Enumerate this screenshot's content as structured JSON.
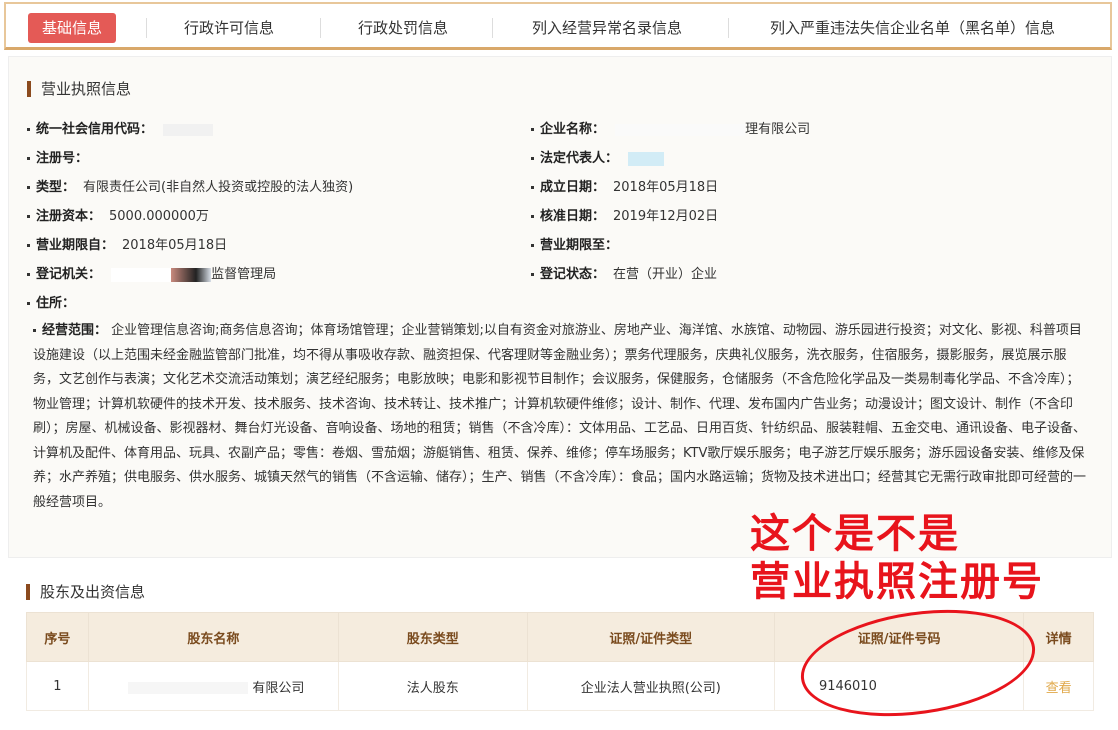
{
  "tabs": [
    {
      "label": "基础信息",
      "active": true
    },
    {
      "label": "行政许可信息",
      "active": false
    },
    {
      "label": "行政处罚信息",
      "active": false
    },
    {
      "label": "列入经营异常名录信息",
      "active": false
    },
    {
      "label": "列入严重违法失信企业名单（黑名单）信息",
      "active": false
    }
  ],
  "license": {
    "title": "营业执照信息",
    "credit_code_label": "统一社会信用代码：",
    "company_name_label": "企业名称：",
    "company_name_value": "理有限公司",
    "reg_no_label": "注册号：",
    "legal_rep_label": "法定代表人：",
    "type_label": "类型：",
    "type_value": "有限责任公司(非自然人投资或控股的法人独资)",
    "est_date_label": "成立日期：",
    "est_date_value": "2018年05月18日",
    "capital_label": "注册资本：",
    "capital_value": "5000.000000万",
    "approve_date_label": "核准日期：",
    "approve_date_value": "2019年12月02日",
    "term_from_label": "营业期限自：",
    "term_from_value": "2018年05月18日",
    "term_to_label": "营业期限至：",
    "authority_label": "登记机关：",
    "authority_value": "监督管理局",
    "status_label": "登记状态：",
    "status_value": "在营（开业）企业",
    "address_label": "住所：",
    "scope_label": "经营范围：",
    "scope_value": "企业管理信息咨询;商务信息咨询；体育场馆管理；企业营销策划;以自有资金对旅游业、房地产业、海洋馆、水族馆、动物园、游乐园进行投资；对文化、影视、科普项目设施建设（以上范围未经金融监管部门批准，均不得从事吸收存款、融资担保、代客理财等金融业务）；票务代理服务，庆典礼仪服务，洗衣服务，住宿服务，摄影服务，展览展示服务，文艺创作与表演；文化艺术交流活动策划；演艺经纪服务；电影放映；电影和影视节目制作；会议服务，保健服务，仓储服务（不含危险化学品及一类易制毒化学品、不含冷库）；物业管理；计算机软硬件的技术开发、技术服务、技术咨询、技术转让、技术推广；计算机软硬件维修；设计、制作、代理、发布国内广告业务；动漫设计；图文设计、制作（不含印刷）；房屋、机械设备、影视器材、舞台灯光设备、音响设备、场地的租赁；销售（不含冷库）：文体用品、工艺品、日用百货、针纺织品、服装鞋帽、五金交电、通讯设备、电子设备、计算机及配件、体育用品、玩具、农副产品；零售：卷烟、雪茄烟；游艇销售、租赁、保养、维修；停车场服务；KTV歌厅娱乐服务；电子游艺厅娱乐服务；游乐园设备安装、维修及保养；水产养殖；供电服务、供水服务、城镇天然气的销售（不含运输、储存）；生产、销售（不含冷库）：食品；国内水路运输；货物及技术进出口；经营其它无需行政审批即可经营的一般经营项目。"
  },
  "annotation": {
    "line1": "这个是不是",
    "line2": "营业执照注册号",
    "color": "#e8141c"
  },
  "shareholders": {
    "title": "股东及出资信息",
    "headers": [
      "序号",
      "股东名称",
      "股东类型",
      "证照/证件类型",
      "证照/证件号码",
      "详情"
    ],
    "rows": [
      [
        "1",
        "有限公司",
        "法人股东",
        "企业法人营业执照(公司)",
        "9146010",
        "查看"
      ]
    ]
  },
  "colors": {
    "active_tab": "#e45a56",
    "tab_border": "#e8c79a",
    "title_bar": "#8b4a1e",
    "table_header_bg": "#f5ecde",
    "link": "#e0a84a"
  }
}
